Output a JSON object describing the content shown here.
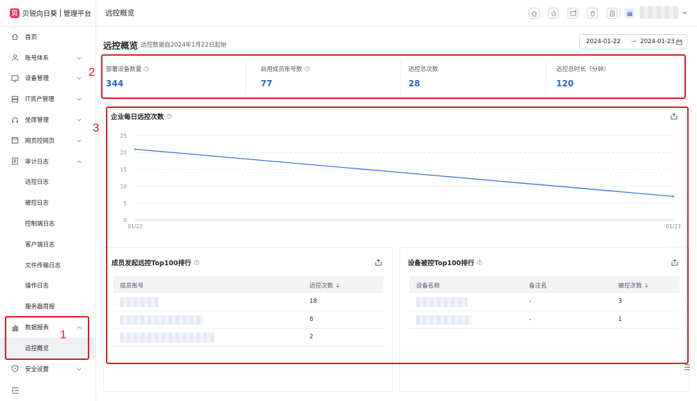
{
  "brand": {
    "logo_letter": "贝",
    "name": "贝锐向日葵",
    "sub": "管理平台"
  },
  "header": {
    "title": "远控概览",
    "user_chevron_icon": "chevron-down-icon",
    "tools": [
      "home-icon",
      "pin-icon",
      "message-icon",
      "trash-icon",
      "document-icon"
    ]
  },
  "sidebar": {
    "items": [
      {
        "label": "首页",
        "icon": "home-icon"
      },
      {
        "label": "账号体系",
        "icon": "user-icon",
        "chevron": "down"
      },
      {
        "label": "设备管理",
        "icon": "monitor-icon",
        "chevron": "down"
      },
      {
        "label": "IT资产管理",
        "icon": "server-icon",
        "chevron": "down"
      },
      {
        "label": "坐席管理",
        "icon": "headset-icon",
        "chevron": "down"
      },
      {
        "label": "网页控网页",
        "icon": "webpage-icon",
        "chevron": "down"
      },
      {
        "label": "审计日志",
        "icon": "log-icon",
        "chevron": "up"
      }
    ],
    "audit_children": [
      "远控日志",
      "被控日志",
      "控制端日志",
      "客户端日志",
      "文件传输日志",
      "操作日志",
      "服务器周报"
    ],
    "report": {
      "label": "数据报表",
      "icon": "chart-bar-icon",
      "chevron": "up",
      "children": [
        "远控概览"
      ]
    },
    "security": {
      "label": "安全设置",
      "icon": "shield-icon",
      "chevron": "down"
    }
  },
  "page": {
    "title": "远控概览",
    "subtitle": "远控数据自2024年1月22日起始",
    "date_start": "2024-01-22",
    "date_sep": "→",
    "date_end": "2024-01-23"
  },
  "stats": [
    {
      "label": "部署设备数量",
      "value": "344",
      "has_help": true
    },
    {
      "label": "启用成员账号数",
      "value": "77",
      "has_help": true
    },
    {
      "label": "远控总次数",
      "value": "28",
      "has_help": false
    },
    {
      "label": "远控总时长（分钟）",
      "value": "120",
      "has_help": false
    }
  ],
  "daily_chart": {
    "title": "企业每日远控次数",
    "chart_data": {
      "type": "line",
      "x": [
        "01/22",
        "01/23"
      ],
      "series": [
        {
          "values": [
            21,
            7
          ]
        }
      ],
      "ylim": [
        0,
        25
      ],
      "yticks": [
        0,
        5,
        10,
        15,
        20,
        25
      ],
      "grid": true,
      "color": "#3b6fe0"
    }
  },
  "member_table": {
    "title": "成员发起远控Top100排行",
    "headers": [
      "成员账号",
      "远控次数"
    ],
    "rows": [
      {
        "count": "18"
      },
      {
        "count": "8"
      },
      {
        "count": "2"
      }
    ]
  },
  "device_table": {
    "title": "设备被控Top100排行",
    "headers": [
      "设备名称",
      "备注名",
      "被控次数"
    ],
    "rows": [
      {
        "remark": "-",
        "count": "3"
      },
      {
        "remark": "-",
        "count": "1"
      }
    ]
  },
  "annotations": [
    "1",
    "2",
    "3"
  ],
  "colors": {
    "accent": "#2f5fcf",
    "annotation": "#e0191f",
    "line": "#3b6fe0"
  }
}
